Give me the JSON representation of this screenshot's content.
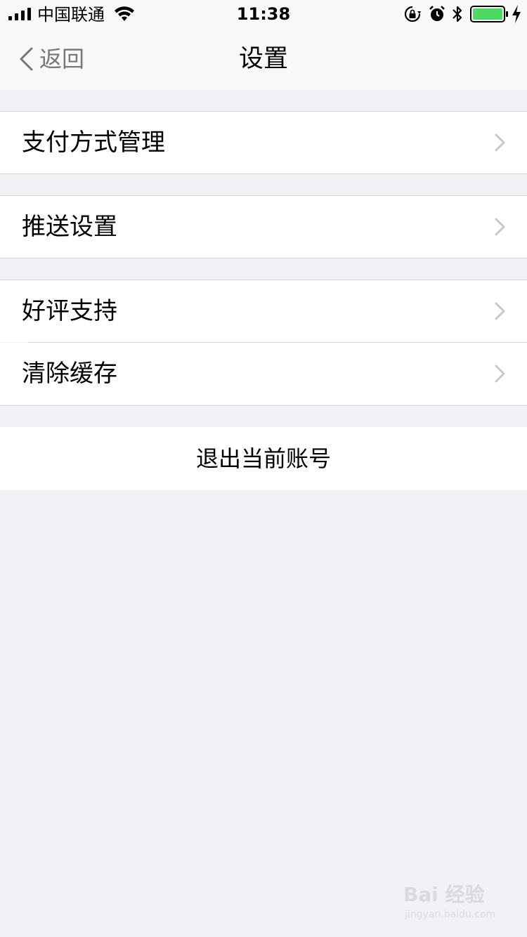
{
  "status_bar": {
    "carrier": "中国联通",
    "time": "11:38",
    "icons": [
      "signal-icon",
      "wifi-icon",
      "rotation-lock-icon",
      "alarm-icon",
      "bluetooth-icon",
      "battery-icon",
      "charging-icon"
    ],
    "battery_color": "#4cd964"
  },
  "nav": {
    "back_label": "返回",
    "title": "设置"
  },
  "sections": [
    {
      "items": [
        {
          "label": "支付方式管理"
        }
      ]
    },
    {
      "items": [
        {
          "label": "推送设置"
        }
      ]
    },
    {
      "items": [
        {
          "label": "好评支持"
        },
        {
          "label": "清除缓存"
        }
      ]
    }
  ],
  "logout": {
    "label": "退出当前账号"
  },
  "watermark": {
    "logo_text": "Bai 经验",
    "url": "jingyan.baidu.com"
  },
  "colors": {
    "background": "#f2f1f6",
    "row_background": "#ffffff",
    "separator": "#d6d6da",
    "chevron": "#c7c7cc",
    "back_text": "#777777"
  }
}
